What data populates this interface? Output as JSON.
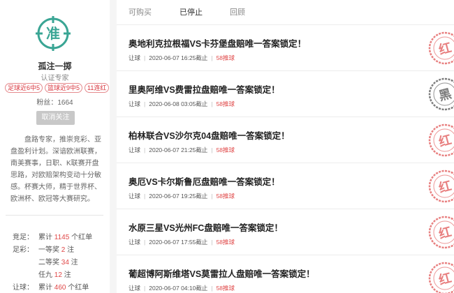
{
  "profile": {
    "avatar_char": "准",
    "username": "孤注一掷",
    "title": "认证专家",
    "badges": [
      "足球近6中5",
      "篮球近9中5",
      "11连红"
    ],
    "fans_label": "粉丝：1664",
    "unfollow_label": "取消关注",
    "bio": "盘路专家，推崇竞彩、亚盘盈利计划。深谙欧洲联赛，南美赛事，日职、K联赛开盘思路，对欧赔架构变动十分敏感。杯赛大师，精于世界杯、欧洲杯、欧冠等大赛研究。"
  },
  "stats": [
    {
      "category": "竞足：",
      "prefix": "累计 ",
      "value": "1145",
      "suffix": " 个红单"
    },
    {
      "category": "足彩：",
      "prefix": "一等奖 ",
      "value": "2",
      "suffix": " 注"
    },
    {
      "category": "",
      "prefix": "二等奖 ",
      "value": "34",
      "suffix": " 注"
    },
    {
      "category": "",
      "prefix": "任九 ",
      "value": "12",
      "suffix": " 注"
    },
    {
      "category": "让球：",
      "prefix": "累计 ",
      "value": "460",
      "suffix": " 个红单"
    }
  ],
  "tabs": [
    "可购买",
    "已停止",
    "回顾"
  ],
  "active_tab": "已停止",
  "articles": [
    {
      "title": "奥地利克拉根福VS卡芬堡盘赔唯一答案锁定！",
      "type": "让球",
      "time": "2020-06-07 16:25截止",
      "price": "58推球",
      "result": "红"
    },
    {
      "title": "里奥阿维VS费雷拉盘赔唯一答案锁定！",
      "type": "让球",
      "time": "2020-06-08 03:05截止",
      "price": "58推球",
      "result": "黑"
    },
    {
      "title": "柏林联合VS沙尔克04盘赔唯一答案锁定！",
      "type": "让球",
      "time": "2020-06-07 21:25截止",
      "price": "58推球",
      "result": "红"
    },
    {
      "title": "奥厄VS卡尔斯鲁厄盘赔唯一答案锁定！",
      "type": "让球",
      "time": "2020-06-07 19:25截止",
      "price": "58推球",
      "result": "红"
    },
    {
      "title": "水原三星VS光州FC盘赔唯一答案锁定！",
      "type": "让球",
      "time": "2020-06-07 17:55截止",
      "price": "58推球",
      "result": "红"
    },
    {
      "title": "葡超博阿斯维塔VS莫雷拉人盘赔唯一答案锁定！",
      "type": "让球",
      "time": "2020-06-07 04:10截止",
      "price": "58推球",
      "result": "红"
    }
  ],
  "colors": {
    "accent_green": "#3aa594",
    "red": "#e04848",
    "stamp_red": "#e46a6a",
    "stamp_black": "#666666"
  }
}
